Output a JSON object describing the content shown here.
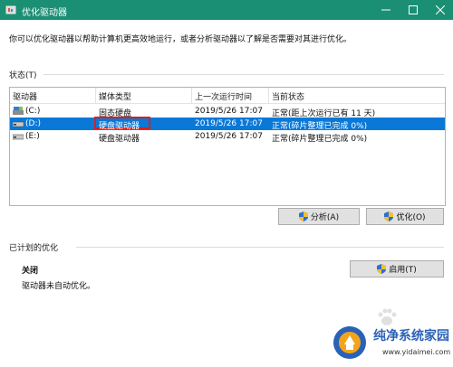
{
  "window": {
    "title": "优化驱动器",
    "controls": [
      "minimize-icon",
      "maximize-icon",
      "close-icon"
    ]
  },
  "description": "你可以优化驱动器以帮助计算机更高效地运行，或者分析驱动器以了解是否需要对其进行优化。",
  "status_section": {
    "label": "状态(T)",
    "columns": [
      "驱动器",
      "媒体类型",
      "上一次运行时间",
      "当前状态"
    ],
    "rows": [
      {
        "drive": "(C:)",
        "media": "固态硬盘",
        "last_run": "2019/5/26 17:07",
        "status": "正常(距上次运行已有 11 天)",
        "selected": false
      },
      {
        "drive": "(D:)",
        "media": "硬盘驱动器",
        "last_run": "2019/5/26 17:07",
        "status": "正常(碎片整理已完成 0%)",
        "selected": true
      },
      {
        "drive": "(E:)",
        "media": "硬盘驱动器",
        "last_run": "2019/5/26 17:07",
        "status": "正常(碎片整理已完成 0%)",
        "selected": false
      }
    ]
  },
  "buttons": {
    "analyze": "分析(A)",
    "optimize": "优化(O)",
    "enable": "启用(T)"
  },
  "scheduled": {
    "label": "已计划的优化",
    "state": "关闭",
    "detail": "驱动器未自动优化。"
  },
  "watermark": {
    "name": "纯净系统家园",
    "url": "www.yidaimei.com"
  },
  "colors": {
    "titlebar": "#1b8f74",
    "selection": "#0a78d7",
    "highlight_box": "#d9201c"
  }
}
